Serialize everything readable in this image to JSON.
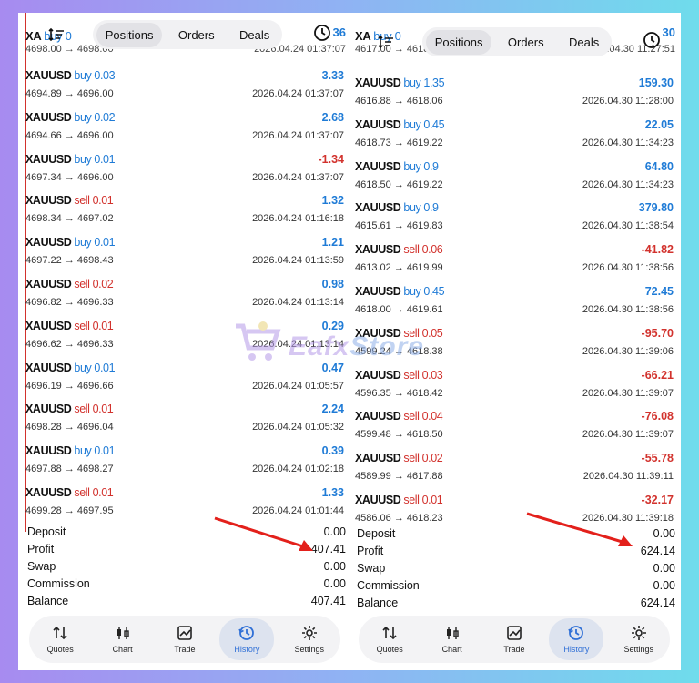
{
  "left": {
    "peek": {
      "symbol": "XA",
      "side": "buy 0",
      "sub": "4698.00 → 4698.00",
      "profit": "36",
      "date": "2026.04.24 01:37:07"
    },
    "tabs": [
      "Positions",
      "Orders",
      "Deals"
    ],
    "deals": [
      {
        "symbol": "XAUUSD",
        "side": "buy",
        "lots": "buy 0.03",
        "prices": "4694.89 → 4696.00",
        "profit": "3.33",
        "time": "2026.04.24 01:37:07"
      },
      {
        "symbol": "XAUUSD",
        "side": "buy",
        "lots": "buy 0.02",
        "prices": "4694.66 → 4696.00",
        "profit": "2.68",
        "time": "2026.04.24 01:37:07"
      },
      {
        "symbol": "XAUUSD",
        "side": "buy",
        "lots": "buy 0.01",
        "prices": "4697.34 → 4696.00",
        "profit": "-1.34",
        "time": "2026.04.24 01:37:07"
      },
      {
        "symbol": "XAUUSD",
        "side": "sell",
        "lots": "sell 0.01",
        "prices": "4698.34 → 4697.02",
        "profit": "1.32",
        "time": "2026.04.24 01:16:18"
      },
      {
        "symbol": "XAUUSD",
        "side": "buy",
        "lots": "buy 0.01",
        "prices": "4697.22 → 4698.43",
        "profit": "1.21",
        "time": "2026.04.24 01:13:59"
      },
      {
        "symbol": "XAUUSD",
        "side": "sell",
        "lots": "sell 0.02",
        "prices": "4696.82 → 4696.33",
        "profit": "0.98",
        "time": "2026.04.24 01:13:14"
      },
      {
        "symbol": "XAUUSD",
        "side": "sell",
        "lots": "sell 0.01",
        "prices": "4696.62 → 4696.33",
        "profit": "0.29",
        "time": "2026.04.24 01:13:14"
      },
      {
        "symbol": "XAUUSD",
        "side": "buy",
        "lots": "buy 0.01",
        "prices": "4696.19 → 4696.66",
        "profit": "0.47",
        "time": "2026.04.24 01:05:57"
      },
      {
        "symbol": "XAUUSD",
        "side": "sell",
        "lots": "sell 0.01",
        "prices": "4698.28 → 4696.04",
        "profit": "2.24",
        "time": "2026.04.24 01:05:32"
      },
      {
        "symbol": "XAUUSD",
        "side": "buy",
        "lots": "buy 0.01",
        "prices": "4697.88 → 4698.27",
        "profit": "0.39",
        "time": "2026.04.24 01:02:18"
      },
      {
        "symbol": "XAUUSD",
        "side": "sell",
        "lots": "sell 0.01",
        "prices": "4699.28 → 4697.95",
        "profit": "1.33",
        "time": "2026.04.24 01:01:44"
      }
    ],
    "summary": [
      {
        "label": "Deposit",
        "value": "0.00"
      },
      {
        "label": "Profit",
        "value": "407.41"
      },
      {
        "label": "Swap",
        "value": "0.00"
      },
      {
        "label": "Commission",
        "value": "0.00"
      },
      {
        "label": "Balance",
        "value": "407.41"
      }
    ]
  },
  "right": {
    "peek": {
      "symbol": "XA",
      "side": "buy 0",
      "sub": "4617.00 → 4618.00",
      "profit": "30",
      "date": "2026.04.30 11:27:51"
    },
    "tabs": [
      "Positions",
      "Orders",
      "Deals"
    ],
    "deals": [
      {
        "symbol": "XAUUSD",
        "side": "buy",
        "lots": "buy 1.35",
        "prices": "4616.88 → 4618.06",
        "profit": "159.30",
        "time": "2026.04.30 11:28:00"
      },
      {
        "symbol": "XAUUSD",
        "side": "buy",
        "lots": "buy 0.45",
        "prices": "4618.73 → 4619.22",
        "profit": "22.05",
        "time": "2026.04.30 11:34:23"
      },
      {
        "symbol": "XAUUSD",
        "side": "buy",
        "lots": "buy 0.9",
        "prices": "4618.50 → 4619.22",
        "profit": "64.80",
        "time": "2026.04.30 11:34:23"
      },
      {
        "symbol": "XAUUSD",
        "side": "buy",
        "lots": "buy 0.9",
        "prices": "4615.61 → 4619.83",
        "profit": "379.80",
        "time": "2026.04.30 11:38:54"
      },
      {
        "symbol": "XAUUSD",
        "side": "sell",
        "lots": "sell 0.06",
        "prices": "4613.02 → 4619.99",
        "profit": "-41.82",
        "time": "2026.04.30 11:38:56"
      },
      {
        "symbol": "XAUUSD",
        "side": "buy",
        "lots": "buy 0.45",
        "prices": "4618.00 → 4619.61",
        "profit": "72.45",
        "time": "2026.04.30 11:38:56"
      },
      {
        "symbol": "XAUUSD",
        "side": "sell",
        "lots": "sell 0.05",
        "prices": "4599.24 → 4618.38",
        "profit": "-95.70",
        "time": "2026.04.30 11:39:06"
      },
      {
        "symbol": "XAUUSD",
        "side": "sell",
        "lots": "sell 0.03",
        "prices": "4596.35 → 4618.42",
        "profit": "-66.21",
        "time": "2026.04.30 11:39:07"
      },
      {
        "symbol": "XAUUSD",
        "side": "sell",
        "lots": "sell 0.04",
        "prices": "4599.48 → 4618.50",
        "profit": "-76.08",
        "time": "2026.04.30 11:39:07"
      },
      {
        "symbol": "XAUUSD",
        "side": "sell",
        "lots": "sell 0.02",
        "prices": "4589.99 → 4617.88",
        "profit": "-55.78",
        "time": "2026.04.30 11:39:11"
      },
      {
        "symbol": "XAUUSD",
        "side": "sell",
        "lots": "sell 0.01",
        "prices": "4586.06 → 4618.23",
        "profit": "-32.17",
        "time": "2026.04.30 11:39:18"
      }
    ],
    "summary": [
      {
        "label": "Deposit",
        "value": "0.00"
      },
      {
        "label": "Profit",
        "value": "624.14"
      },
      {
        "label": "Swap",
        "value": "0.00"
      },
      {
        "label": "Commission",
        "value": "0.00"
      },
      {
        "label": "Balance",
        "value": "624.14"
      }
    ]
  },
  "nav": [
    {
      "label": "Quotes",
      "icon": "quotes-icon"
    },
    {
      "label": "Chart",
      "icon": "chart-icon"
    },
    {
      "label": "Trade",
      "icon": "trade-icon"
    },
    {
      "label": "History",
      "icon": "history-icon",
      "active": true
    },
    {
      "label": "Settings",
      "icon": "settings-icon"
    }
  ],
  "watermark": {
    "text_a": "Eafx",
    "text_b": "Store"
  },
  "colors": {
    "buy": "#1f7bd6",
    "sell": "#d2322d",
    "accent": "#2f6fd6"
  }
}
